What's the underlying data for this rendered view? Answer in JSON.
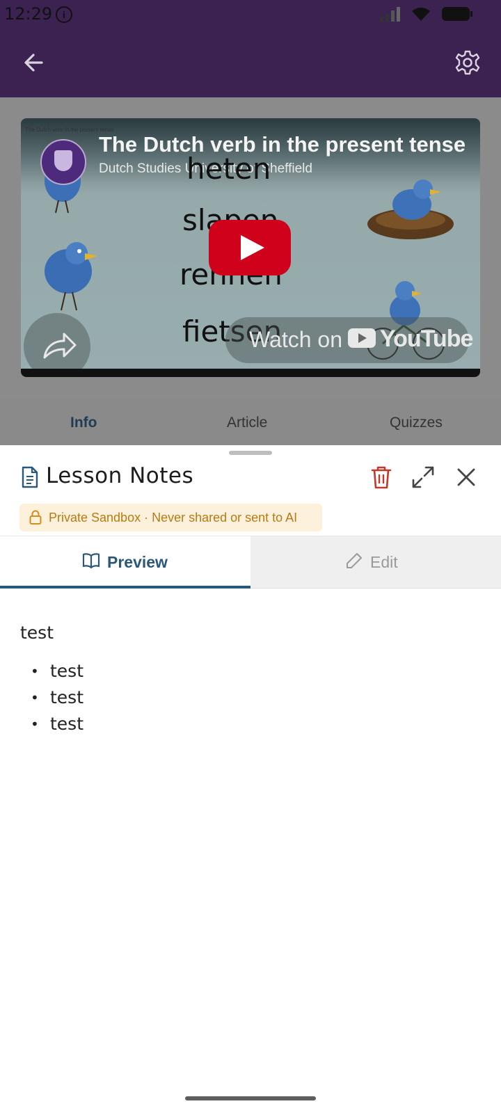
{
  "status_bar": {
    "time": "12:29",
    "info_icon": "info-icon",
    "icons": [
      "signal-icon",
      "wifi-icon",
      "battery-icon"
    ]
  },
  "app_bar": {
    "back_icon": "arrow-left-icon",
    "settings_icon": "gear-icon",
    "background": "#3b2251"
  },
  "video": {
    "tiny_title": "The Dutch verb in the present tense",
    "title": "The Dutch verb in the present tense",
    "channel": "Dutch Studies University of Sheffield",
    "words": [
      "heten",
      "slapen",
      "rennen",
      "fietsen"
    ],
    "watch_on": "Watch on",
    "youtube": "YouTube"
  },
  "lesson_tabs": [
    {
      "label": "Info",
      "active": true
    },
    {
      "label": "Article",
      "active": false
    },
    {
      "label": "Quizzes",
      "active": false
    }
  ],
  "sheet": {
    "title": "Lesson Notes",
    "badge": "Private Sandbox · Never shared or sent to AI",
    "segments": {
      "preview": "Preview",
      "edit": "Edit",
      "active": "preview"
    },
    "note": {
      "paragraph": "test",
      "items": [
        "test",
        "test",
        "test"
      ]
    }
  },
  "colors": {
    "accent": "#2b5878",
    "danger": "#c0392b",
    "badge_text": "#b97a12",
    "badge_bg": "#fdf1dc",
    "youtube_red": "#d0021b"
  }
}
